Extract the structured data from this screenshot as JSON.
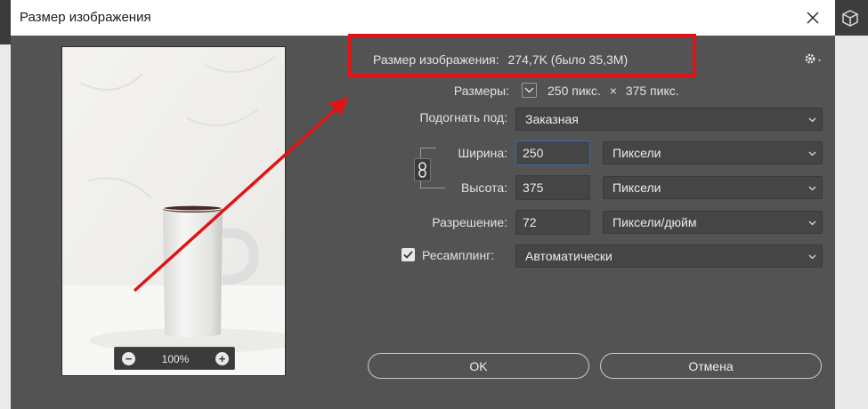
{
  "dialog": {
    "title": "Размер изображения"
  },
  "preview": {
    "zoom": "100%",
    "zoom_out": "−",
    "zoom_in": "+"
  },
  "image_size": {
    "label": "Размер изображения:",
    "value": "274,7K (было 35,3M)"
  },
  "dimensions": {
    "label": "Размеры:",
    "width_value": "250 пикс.",
    "separator": "×",
    "height_value": "375 пикс."
  },
  "fit_to": {
    "label": "Подогнать под:",
    "value": "Заказная"
  },
  "width": {
    "label": "Ширина:",
    "value": "250",
    "unit": "Пиксели"
  },
  "height": {
    "label": "Высота:",
    "value": "375",
    "unit": "Пиксели"
  },
  "resolution": {
    "label": "Разрешение:",
    "value": "72",
    "unit": "Пиксели/дюйм"
  },
  "resample": {
    "label": "Ресамплинг:",
    "checked": true,
    "value": "Автоматически"
  },
  "buttons": {
    "ok": "OK",
    "cancel": "Отмена"
  },
  "colors": {
    "annotation": "#e01414",
    "focus": "#2d6fb5",
    "dialog_bg": "#535353"
  }
}
